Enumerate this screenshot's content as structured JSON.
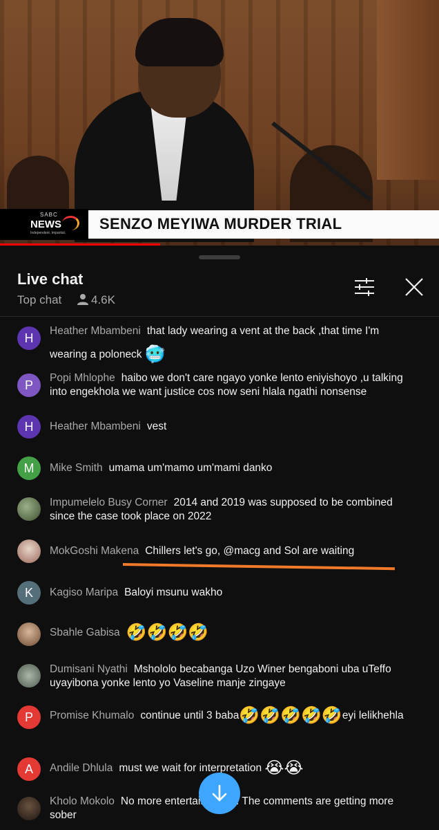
{
  "video": {
    "logo_sabc": "SABC",
    "logo_news": "NEWS",
    "logo_tagline": "Independent. Impartial.",
    "headline": "SENZO MEYIWA MURDER TRIAL",
    "progress_fraction": 0.365
  },
  "chat": {
    "title": "Live chat",
    "mode": "Top chat",
    "viewer_count": "4.6K",
    "messages": [
      {
        "author": "Heather Mbambeni",
        "avatar_letter": "H",
        "avatar_color": "#5e35b1",
        "text": "that lady wearing a vent at the back ,that time I'm wearing a poloneck",
        "emoji": "🥶"
      },
      {
        "author": "Popi Mhlophe",
        "avatar_letter": "P",
        "avatar_color": "#7e57c2",
        "text": "haibo we don't care ngayo yonke lento eniyishoyo ,u talking into engekhola we want justice cos now seni hlala ngathi nonsense"
      },
      {
        "author": "Heather Mbambeni",
        "avatar_letter": "H",
        "avatar_color": "#5e35b1",
        "text": "vest"
      },
      {
        "author": "Mike Smith",
        "avatar_letter": "M",
        "avatar_color": "#43a047",
        "text": "umama um'mamo um'mami danko"
      },
      {
        "author": "Impumelelo Busy Corner",
        "avatar_letter": "",
        "avatar_color": "#5b6b4a",
        "text": "2014 and 2019 was supposed to be combined since the case took place on 2022"
      },
      {
        "author": "MokGoshi Makena",
        "avatar_letter": "",
        "avatar_color": "#b08a7a",
        "text": "Chillers let's go, @macg and Sol are waiting"
      },
      {
        "author": "Kagiso Maripa",
        "avatar_letter": "K",
        "avatar_color": "#546e7a",
        "text": "Baloyi msunu wakho"
      },
      {
        "author": "Sbahle Gabisa",
        "avatar_letter": "",
        "avatar_color": "#8d6e63",
        "text": "",
        "emoji": "🤣🤣🤣🤣"
      },
      {
        "author": "Dumisani Nyathi",
        "avatar_letter": "",
        "avatar_color": "#6b7a6e",
        "text": "Msholo​lo becabanga Uzo Winer bengaboni uba uTeffo uyayibona yonke lento yo Vaseline manje zingaye"
      },
      {
        "author": "Promise Khumalo",
        "avatar_letter": "P",
        "avatar_color": "#e53935",
        "text": "continue until 3 baba",
        "emoji": "🤣🤣🤣🤣🤣",
        "text_after": "eyi lelikhehla"
      },
      {
        "author": "Andile Dhlula",
        "avatar_letter": "A",
        "avatar_color": "#e53935",
        "text": "must we wait for interpretation",
        "emoji": "😭😭"
      },
      {
        "author": "Kholo Mokolo",
        "avatar_letter": "",
        "avatar_color": "#3a2c22",
        "text": "No more entertainment... The comments are getting more sober"
      }
    ]
  },
  "colors": {
    "accent": "#3ea6ff",
    "annotation": "#f07a2a",
    "progress": "#ff0000"
  },
  "icons": {
    "filter": "sliders-icon",
    "close": "close-icon",
    "viewers": "person-icon",
    "scroll": "arrow-down-icon"
  }
}
